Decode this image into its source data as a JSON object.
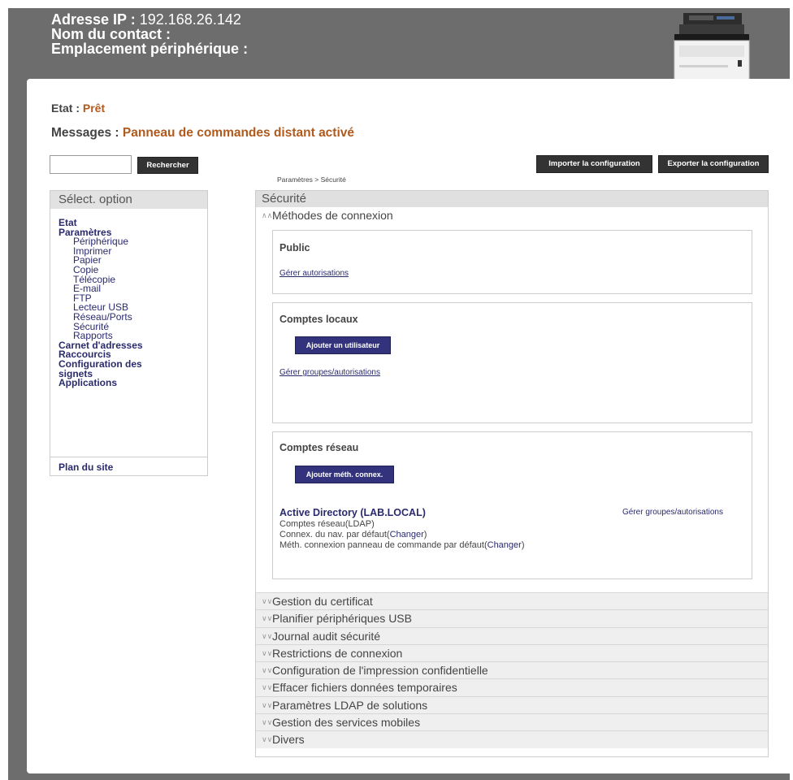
{
  "header": {
    "ip_label": "Adresse IP : ",
    "ip_value": "192.168.26.142",
    "contact_label": "Nom du contact :",
    "location_label": "Emplacement périphérique :"
  },
  "status": {
    "label": "Etat : ",
    "value": "Prêt"
  },
  "messages": {
    "label": "Messages : ",
    "value": "Panneau de commandes distant activé"
  },
  "search": {
    "value": "",
    "button": "Rechercher"
  },
  "toolbar": {
    "import": "Importer la configuration",
    "export": "Exporter la configuration"
  },
  "breadcrumb": "Paramètres > Sécurité",
  "sidebar": {
    "header": "Sélect. option",
    "items": [
      {
        "label": "Etat",
        "level": 0
      },
      {
        "label": "Paramètres",
        "level": 0
      },
      {
        "label": "Périphérique",
        "level": 1
      },
      {
        "label": "Imprimer",
        "level": 1
      },
      {
        "label": "Papier",
        "level": 1
      },
      {
        "label": "Copie",
        "level": 1
      },
      {
        "label": "Télécopie",
        "level": 1
      },
      {
        "label": "E-mail",
        "level": 1
      },
      {
        "label": "FTP",
        "level": 1
      },
      {
        "label": "Lecteur USB",
        "level": 1
      },
      {
        "label": "Réseau/Ports",
        "level": 1
      },
      {
        "label": "Sécurité",
        "level": 1
      },
      {
        "label": "Rapports",
        "level": 1
      },
      {
        "label": "Carnet d'adresses",
        "level": 0
      },
      {
        "label": "Raccourcis",
        "level": 0
      },
      {
        "label": "Configuration des",
        "level": 0
      },
      {
        "label": "signets",
        "level": 0
      },
      {
        "label": "Applications",
        "level": 0
      }
    ],
    "sitemap": "Plan du site"
  },
  "main": {
    "title": "Sécurité",
    "open_section": "Méthodes de connexion",
    "public": {
      "title": "Public",
      "link": "Gérer autorisations"
    },
    "local": {
      "title": "Comptes locaux",
      "button": "Ajouter un utilisateur",
      "link": "Gérer groupes/autorisations"
    },
    "network": {
      "title": "Comptes réseau",
      "button": "Ajouter méth. connex.",
      "ad_title": "Active Directory (LAB.LOCAL)",
      "manage": "Gérer groupes/autorisations",
      "line1": "Comptes réseau(LDAP)",
      "line2_text": "Connex. du nav. par défaut(",
      "line2_link": "Changer",
      "line2_end": ")",
      "line3_text": "Méth. connexion panneau de commande par défaut(",
      "line3_link": "Changer",
      "line3_end": ")"
    },
    "sections": [
      "Gestion du certificat",
      "Planifier périphériques USB",
      "Journal audit sécurité",
      "Restrictions de connexion",
      "Configuration de l'impression confidentielle",
      "Effacer fichiers données temporaires",
      "Paramètres LDAP de solutions",
      "Gestion des services mobiles",
      "Divers"
    ]
  },
  "colors": {
    "header_bg": "#6d6d6d",
    "accent": "#b05a1d",
    "link": "#2a2a6e",
    "button_purple": "#33337d"
  },
  "icons": {
    "expanded": "chevron-up-double-icon",
    "collapsed": "chevron-down-double-icon",
    "device": "printer-image"
  }
}
